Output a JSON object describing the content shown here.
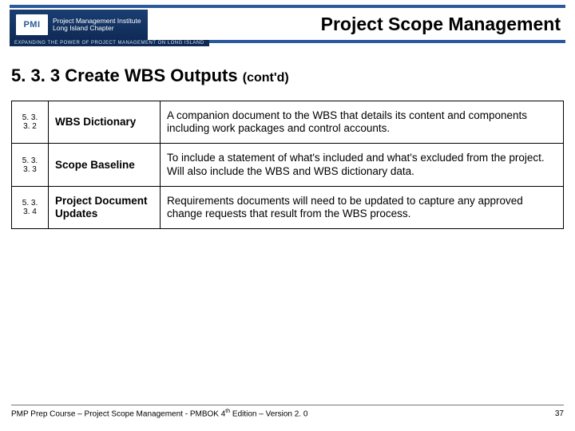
{
  "header": {
    "logo_abbrev": "PMI",
    "logo_line1": "Project Management Institute",
    "logo_line2": "Long Island Chapter",
    "logo_tagline": "EXPANDING THE POWER OF PROJECT MANAGEMENT ON LONG ISLAND",
    "title": "Project Scope Management"
  },
  "section": {
    "number_and_title": "5. 3. 3 Create WBS Outputs ",
    "cont": "(cont'd)"
  },
  "table": {
    "rows": [
      {
        "num": "5. 3. 3. 2",
        "name": "WBS Dictionary",
        "desc": "A companion document to the WBS that details its content and components including work packages and control accounts."
      },
      {
        "num": "5. 3. 3. 3",
        "name": "Scope Baseline",
        "desc": "To include a statement of what's included and what's excluded from the project. Will also include the WBS and WBS dictionary data."
      },
      {
        "num": "5. 3. 3. 4",
        "name": "Project Document Updates",
        "desc": "Requirements documents will need to be updated to capture any approved change requests that result from the WBS process."
      }
    ]
  },
  "footer": {
    "left_a": "PMP Prep Course – Project Scope Management - PMBOK 4",
    "left_sup": "th",
    "left_b": " Edition – Version 2. 0",
    "page": "37"
  }
}
